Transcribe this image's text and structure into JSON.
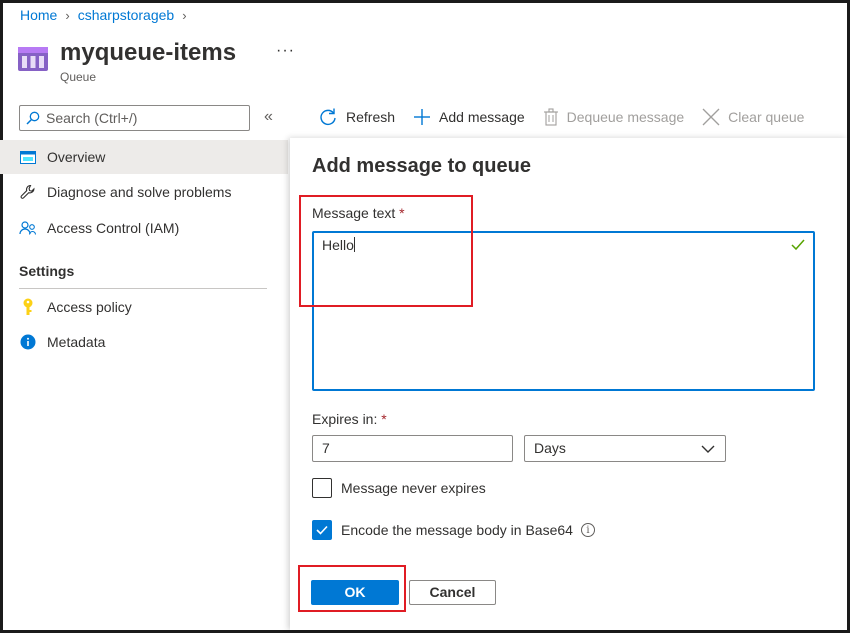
{
  "breadcrumb": {
    "home": "Home",
    "account": "csharpstorageb"
  },
  "header": {
    "title": "myqueue-items",
    "subtitle": "Queue",
    "more": "···"
  },
  "sidebar": {
    "search_placeholder": "Search (Ctrl+/)",
    "collapse": "«",
    "items": [
      {
        "label": "Overview",
        "icon": "overview-icon"
      },
      {
        "label": "Diagnose and solve problems",
        "icon": "wrench-icon"
      },
      {
        "label": "Access Control (IAM)",
        "icon": "people-icon"
      }
    ],
    "section": "Settings",
    "settings_items": [
      {
        "label": "Access policy",
        "icon": "key-icon"
      },
      {
        "label": "Metadata",
        "icon": "info-icon"
      }
    ]
  },
  "toolbar": {
    "refresh": "Refresh",
    "add_message": "Add message",
    "dequeue_message": "Dequeue message",
    "clear_queue": "Clear queue"
  },
  "panel": {
    "title": "Add message to queue",
    "message_label": "Message text",
    "message_value": "Hello",
    "expires_label": "Expires in:",
    "expires_value": "7",
    "expires_unit": "Days",
    "never_expires_label": "Message never expires",
    "never_expires_checked": false,
    "base64_label": "Encode the message body in Base64",
    "base64_checked": true,
    "required_mark": "*",
    "ok": "OK",
    "cancel": "Cancel"
  },
  "colors": {
    "accent": "#0078d4",
    "highlight": "#e01c24",
    "required": "#a4262c",
    "success": "#57a300"
  }
}
